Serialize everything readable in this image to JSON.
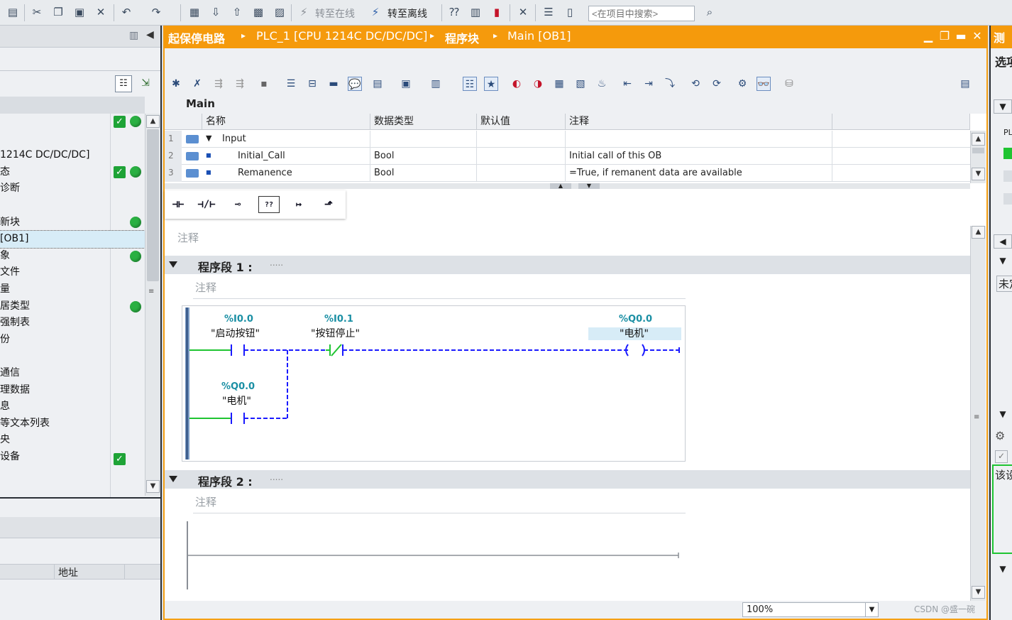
{
  "toolbar": {
    "go_online": "转至在线",
    "go_offline": "转至离线",
    "search_placeholder": "<在项目中搜索>"
  },
  "left_panel": {
    "tree_items": [
      "",
      "",
      "1214C DC/DC/DC]",
      "态",
      "诊断",
      "",
      "新块",
      "[OB1]",
      "象",
      "文件",
      "量",
      "居类型",
      "强制表",
      "份",
      "",
      "通信",
      "理数据",
      "息",
      "等文本列表",
      "央",
      "设备"
    ],
    "details_header": "地址"
  },
  "editor": {
    "breadcrumb": {
      "project": "起保停电路",
      "device": "PLC_1 [CPU 1214C DC/DC/DC]",
      "folder": "程序块",
      "block": "Main [OB1]"
    },
    "block_name": "Main",
    "interface": {
      "columns": [
        "名称",
        "数据类型",
        "默认值",
        "注释"
      ],
      "rows": [
        {
          "num": "1",
          "name": "Input",
          "type": "",
          "default": "",
          "comment": ""
        },
        {
          "num": "2",
          "name": "Initial_Call",
          "type": "Bool",
          "default": "",
          "comment": "Initial call of this OB"
        },
        {
          "num": "3",
          "name": "Remanence",
          "type": "Bool",
          "default": "",
          "comment": "=True, if remanent data are available"
        }
      ]
    },
    "block_comment": "注释",
    "networks": [
      {
        "title": "程序段 1 :",
        "dots": ".....",
        "comment": "注释",
        "contacts": [
          {
            "addr": "%I0.0",
            "name": "\"启动按钮\""
          },
          {
            "addr": "%I0.1",
            "name": "\"按钮停止\""
          },
          {
            "addr": "%Q0.0",
            "name": "\"电机\""
          }
        ],
        "coil": {
          "addr": "%Q0.0",
          "name": "\"电机\""
        }
      },
      {
        "title": "程序段 2 :",
        "dots": ".....",
        "comment": "注释"
      }
    ],
    "zoom": "100%"
  },
  "right_panel": {
    "tab1": "测",
    "tab2": "选项",
    "label_pl": "PL",
    "label_unset": "未定",
    "label_setting": "该设"
  },
  "watermark": "CSDN @盛一碗"
}
